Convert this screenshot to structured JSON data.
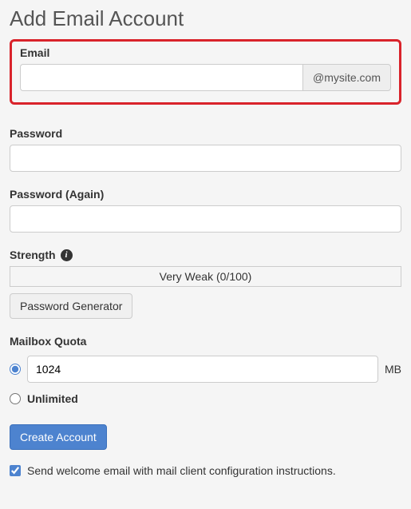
{
  "page": {
    "title": "Add Email Account"
  },
  "labels": {
    "email": "Email",
    "domain_addon": "@mysite.com",
    "password": "Password",
    "password_again": "Password (Again)",
    "strength": "Strength",
    "strength_value": "Very Weak (0/100)",
    "password_generator": "Password Generator",
    "mailbox_quota": "Mailbox Quota",
    "quota_unit": "MB",
    "unlimited": "Unlimited",
    "create_account": "Create Account",
    "welcome_email": "Send welcome email with mail client configuration instructions."
  },
  "values": {
    "email": "",
    "password": "",
    "password_again": "",
    "quota": "1024",
    "quota_mode": "fixed",
    "welcome_checked": true
  }
}
